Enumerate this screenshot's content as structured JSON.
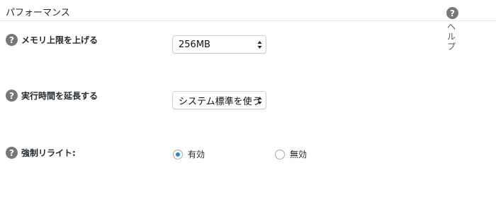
{
  "section": {
    "title": "パフォーマンス",
    "help_icon": "?",
    "help_label": "ヘルプ"
  },
  "rows": [
    {
      "icon": "?",
      "label": "メモリ上限を上げる",
      "value": "256MB"
    },
    {
      "icon": "?",
      "label": "実行時間を延長する",
      "value": "システム標準を使う"
    },
    {
      "icon": "?",
      "label": "強制リライト:",
      "options": [
        {
          "label": "有効",
          "checked": true
        },
        {
          "label": "無効",
          "checked": false
        }
      ]
    }
  ],
  "colors": {
    "icon_bg": "#777777",
    "radio_accent": "#1e8cbe"
  }
}
